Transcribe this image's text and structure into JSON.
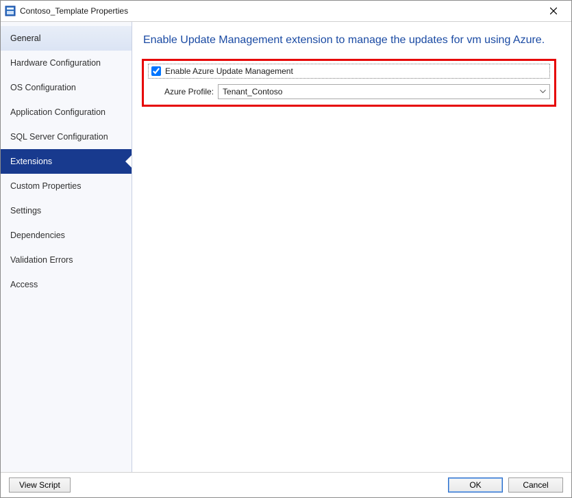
{
  "window": {
    "title": "Contoso_Template Properties"
  },
  "sidebar": {
    "items": [
      {
        "label": "General",
        "state": "first"
      },
      {
        "label": "Hardware Configuration",
        "state": ""
      },
      {
        "label": "OS Configuration",
        "state": ""
      },
      {
        "label": "Application Configuration",
        "state": ""
      },
      {
        "label": "SQL Server Configuration",
        "state": ""
      },
      {
        "label": "Extensions",
        "state": "active"
      },
      {
        "label": "Custom Properties",
        "state": ""
      },
      {
        "label": "Settings",
        "state": ""
      },
      {
        "label": "Dependencies",
        "state": ""
      },
      {
        "label": "Validation Errors",
        "state": ""
      },
      {
        "label": "Access",
        "state": ""
      }
    ]
  },
  "content": {
    "heading": "Enable Update Management extension to manage the updates for vm using Azure.",
    "checkbox_label": "Enable Azure Update Management",
    "checkbox_checked": true,
    "profile_label": "Azure Profile:",
    "profile_value": "Tenant_Contoso"
  },
  "footer": {
    "view_script": "View Script",
    "ok": "OK",
    "cancel": "Cancel"
  },
  "colors": {
    "accent": "#183a8e",
    "heading": "#1a4aa3",
    "callout": "#e60000"
  }
}
